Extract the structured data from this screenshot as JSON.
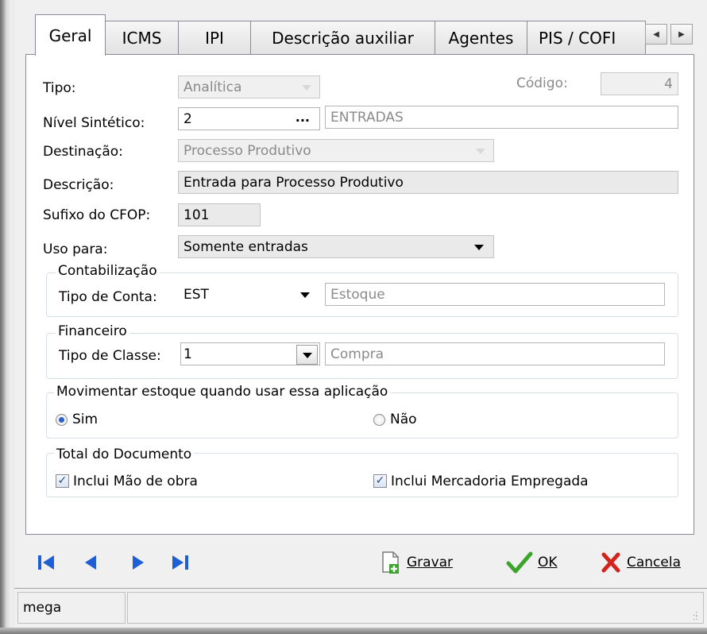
{
  "tabs": [
    {
      "label": "Geral",
      "active": true
    },
    {
      "label": "ICMS",
      "active": false
    },
    {
      "label": "IPI",
      "active": false
    },
    {
      "label": "Descrição auxiliar",
      "active": false
    },
    {
      "label": "Agentes",
      "active": false
    },
    {
      "label": "PIS / COFI",
      "active": false
    }
  ],
  "form": {
    "tipo_label": "Tipo:",
    "tipo_value": "Analítica",
    "codigo_label": "Código:",
    "codigo_value": "4",
    "nivel_label": "Nível Sintético:",
    "nivel_value": "2",
    "nivel_ellipsis": "...",
    "nivel_desc": "ENTRADAS",
    "destinacao_label": "Destinação:",
    "destinacao_value": "Processo Produtivo",
    "descricao_label": "Descrição:",
    "descricao_value": "Entrada para Processo Produtivo",
    "sufixo_label": "Sufixo do CFOP:",
    "sufixo_value": "101",
    "uso_label": "Uso para:",
    "uso_value": "Somente entradas"
  },
  "contabilizacao": {
    "legend": "Contabilização",
    "tipo_conta_label": "Tipo de Conta:",
    "tipo_conta_value": "EST",
    "tipo_conta_desc": "Estoque"
  },
  "financeiro": {
    "legend": "Financeiro",
    "tipo_classe_label": "Tipo de Classe:",
    "tipo_classe_value": "1",
    "tipo_classe_desc": "Compra"
  },
  "movimentar": {
    "legend": "Movimentar estoque quando usar essa aplicação",
    "sim_label": "Sim",
    "sim_selected": true,
    "nao_label": "Não",
    "nao_selected": false
  },
  "total": {
    "legend": "Total do Documento",
    "mao_obra_label": "Inclui Mão de obra",
    "mao_obra_checked": true,
    "mercadoria_label": "Inclui Mercadoria Empregada",
    "mercadoria_checked": true
  },
  "actions": {
    "gravar_label": "Gravar",
    "ok_label": "OK",
    "cancela_label": "Cancela"
  },
  "status": {
    "user": "mega"
  },
  "colors": {
    "nav_blue": "#1f5fd6",
    "ok_green": "#3aa52a",
    "cancel_red": "#d2231c"
  },
  "icons": [
    "first-record-icon",
    "previous-record-icon",
    "next-record-icon",
    "last-record-icon",
    "save-icon",
    "ok-check-icon",
    "cancel-x-icon"
  ]
}
